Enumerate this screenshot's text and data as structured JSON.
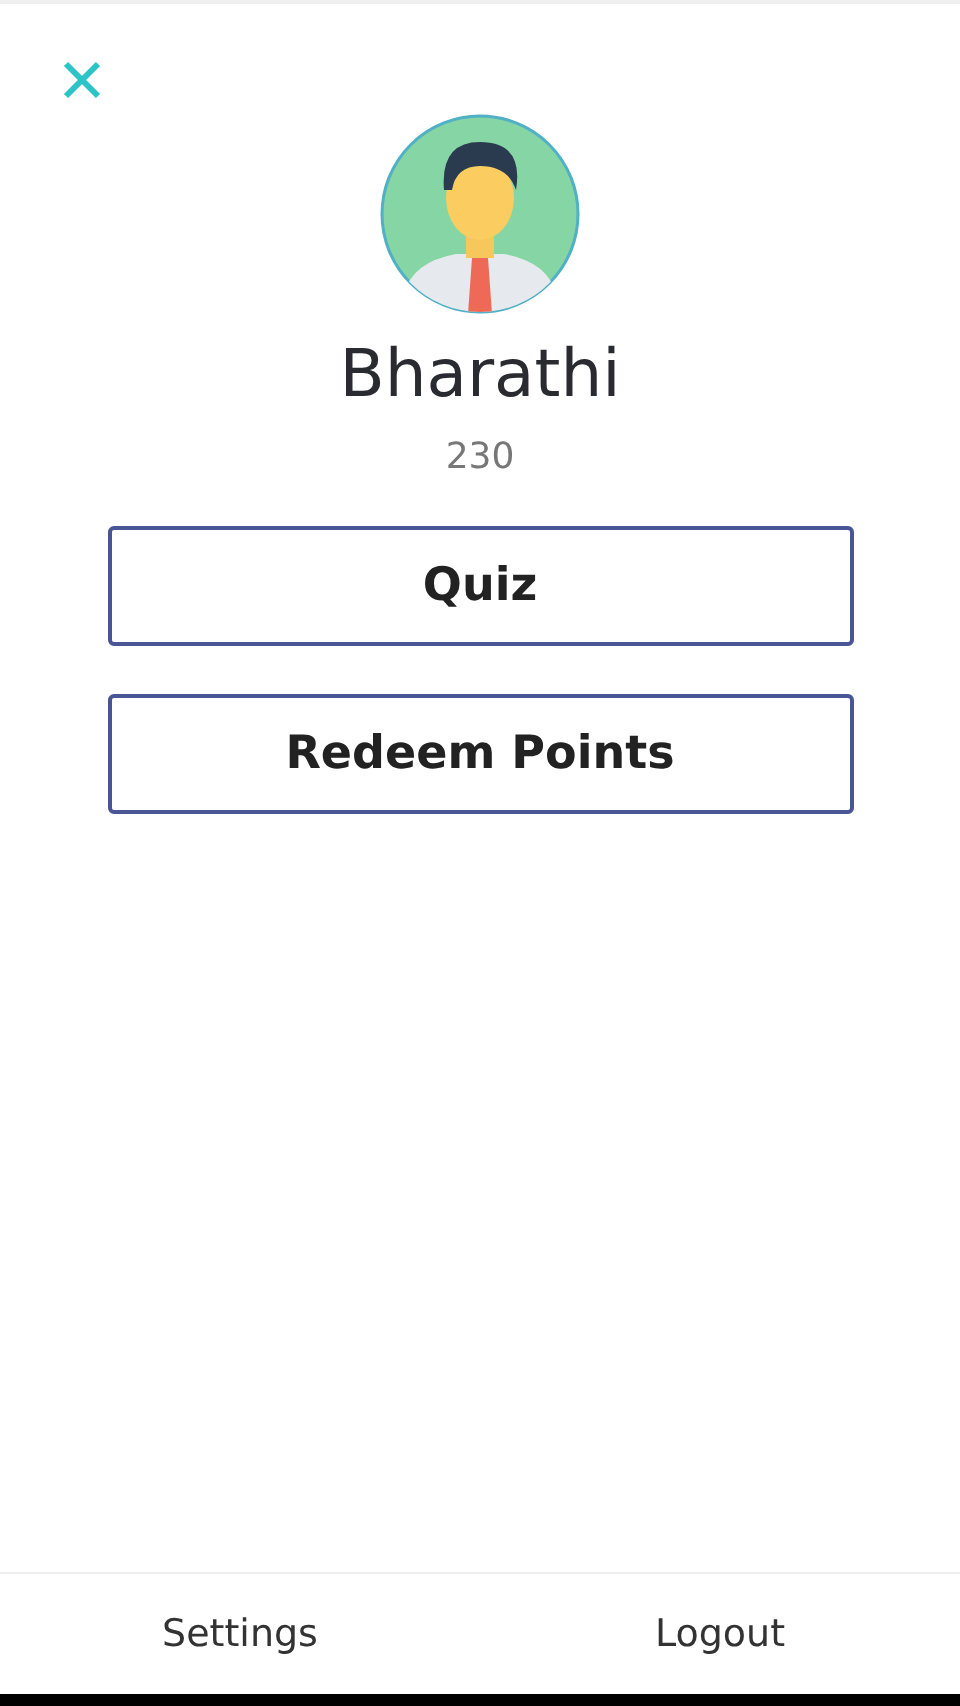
{
  "profile": {
    "name": "Bharathi",
    "points": "230"
  },
  "buttons": [
    {
      "label": "Quiz"
    },
    {
      "label": "Redeem Points"
    }
  ],
  "footer": [
    {
      "label": "Settings"
    },
    {
      "label": "Logout"
    }
  ]
}
